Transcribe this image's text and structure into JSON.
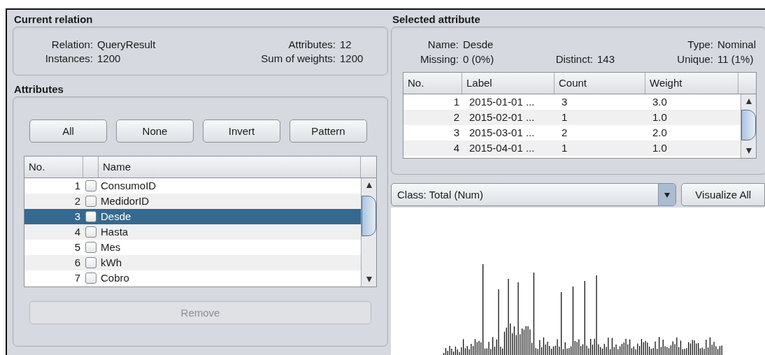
{
  "current_relation": {
    "title": "Current relation",
    "relation_label": "Relation:",
    "relation": "QueryResult",
    "instances_label": "Instances:",
    "instances": "1200",
    "attributes_label": "Attributes:",
    "attributes": "12",
    "sum_label": "Sum of weights:",
    "sum": "1200"
  },
  "attributes": {
    "title": "Attributes",
    "buttons": [
      "All",
      "None",
      "Invert",
      "Pattern"
    ],
    "columns": [
      "No.",
      "Name"
    ],
    "rows": [
      {
        "no": "1",
        "name": "ConsumoID",
        "checked": false,
        "selected": false
      },
      {
        "no": "2",
        "name": "MedidorID",
        "checked": false,
        "selected": false
      },
      {
        "no": "3",
        "name": "Desde",
        "checked": false,
        "selected": true
      },
      {
        "no": "4",
        "name": "Hasta",
        "checked": false,
        "selected": false
      },
      {
        "no": "5",
        "name": "Mes",
        "checked": false,
        "selected": false
      },
      {
        "no": "6",
        "name": "kWh",
        "checked": false,
        "selected": false
      },
      {
        "no": "7",
        "name": "Cobro",
        "checked": false,
        "selected": false
      }
    ],
    "remove_button": {
      "label": "Remove",
      "disabled": true
    }
  },
  "selected_attribute": {
    "title": "Selected attribute",
    "name_label": "Name:",
    "name": "Desde",
    "type_label": "Type:",
    "type": "Nominal",
    "missing_label": "Missing:",
    "missing": "0 (0%)",
    "distinct_label": "Distinct:",
    "distinct": "143",
    "unique_label": "Unique:",
    "unique": "11 (1%)",
    "columns": [
      "No.",
      "Label",
      "Count",
      "Weight"
    ],
    "rows": [
      {
        "no": "1",
        "label": "2015-01-01 ...",
        "count": "3",
        "weight": "3.0"
      },
      {
        "no": "2",
        "label": "2015-02-01 ...",
        "count": "1",
        "weight": "1.0"
      },
      {
        "no": "3",
        "label": "2015-03-01 ...",
        "count": "2",
        "weight": "2.0"
      },
      {
        "no": "4",
        "label": "2015-04-01 ...",
        "count": "1",
        "weight": "1.0"
      }
    ]
  },
  "class_select": {
    "value": "Class: Total (Num)"
  },
  "visualize_button": {
    "label": "Visualize All"
  }
}
